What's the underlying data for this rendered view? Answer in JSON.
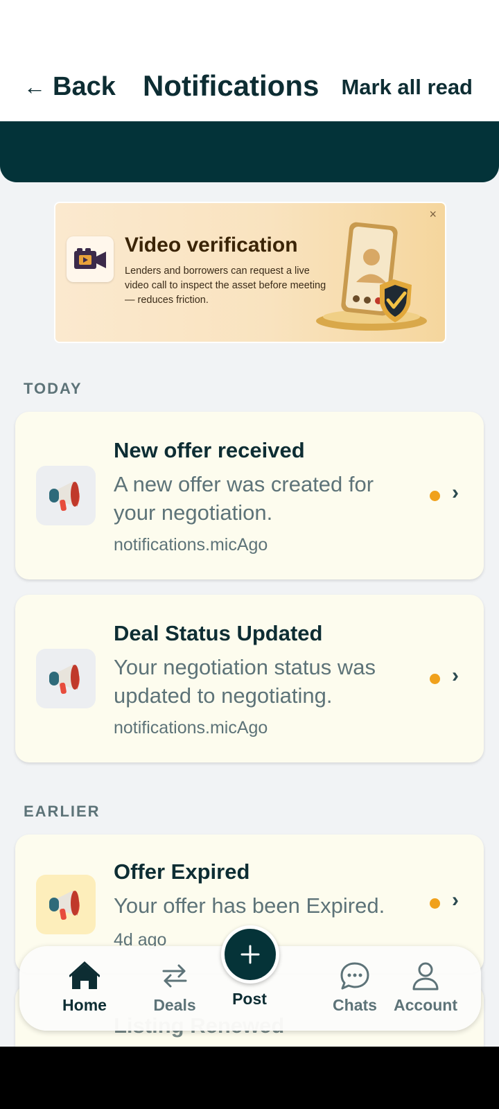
{
  "header": {
    "back_label": "Back",
    "back_icon": "←",
    "title": "Notifications",
    "mark_all_label": "Mark all read"
  },
  "banner": {
    "title": "Video verification",
    "text": "Lenders and borrowers can request a live video call to inspect the asset before meeting — reduces friction.",
    "close_icon": "×"
  },
  "sections": {
    "today": "TODAY",
    "earlier": "EARLIER"
  },
  "notifications": [
    {
      "title": "New offer received",
      "body": "A new offer was created for your negotiation.",
      "time": "notifications.micAgo",
      "unread": true
    },
    {
      "title": "Deal Status Updated",
      "body": "Your negotiation status was updated to negotiating.",
      "time": "notifications.micAgo",
      "unread": true
    },
    {
      "title": "Offer Expired",
      "body": "Your offer has been Expired.",
      "time": "4d ago",
      "unread": true
    },
    {
      "title": "Listing Renewed"
    }
  ],
  "nav": {
    "home": "Home",
    "deals": "Deals",
    "post": "Post",
    "chats": "Chats",
    "account": "Account"
  },
  "colors": {
    "brand": "#033339",
    "unread_dot": "#f0a11c",
    "card_bg": "#fdfcee"
  }
}
